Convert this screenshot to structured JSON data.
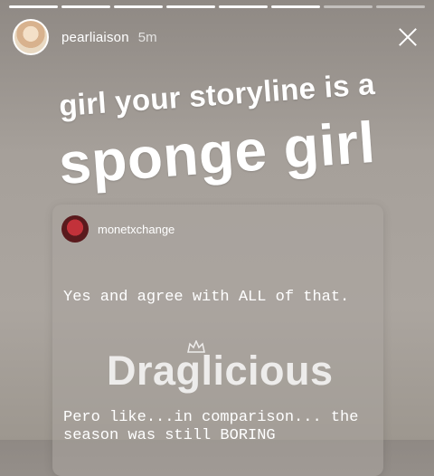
{
  "progress": {
    "segments": 8,
    "current": 6
  },
  "header": {
    "username": "pearliaison",
    "time": "5m"
  },
  "caption": {
    "line1": "girl your storyline is a",
    "line2": "sponge girl"
  },
  "shared_post": {
    "username": "monetxchange",
    "text1": "Yes and agree with ALL of that.",
    "text2": "Pero like...in comparison... the season was still BORING"
  },
  "watermark": {
    "text": "Draglicious"
  },
  "icons": {
    "close": "close-icon",
    "watermark_crown": "crown-icon"
  },
  "colors": {
    "text": "#ffffff",
    "post_avatar": "#c2323a"
  }
}
